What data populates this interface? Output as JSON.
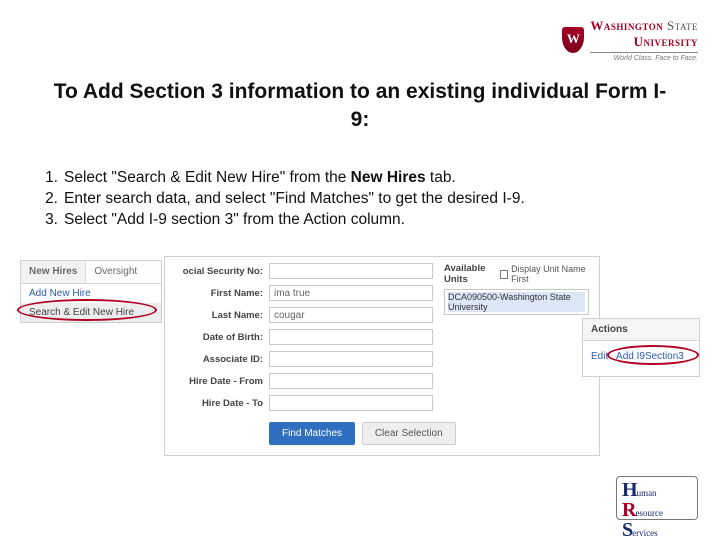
{
  "brand": {
    "wordmark_a": "Washington",
    "wordmark_b": "State",
    "wordmark_c": "University",
    "tagline": "World Class. Face to Face."
  },
  "title": "To Add Section 3 information to an existing individual Form I-9:",
  "steps": [
    {
      "n": "1.",
      "pre": "Select \"Search & Edit New Hire\" from the ",
      "bold": "New Hires",
      "post": " tab."
    },
    {
      "n": "2.",
      "pre": "Enter search data, and select \"Find Matches\" to get the desired I-9.",
      "bold": "",
      "post": ""
    },
    {
      "n": "3.",
      "pre": "Select \"Add I-9 section 3\" from the Action column.",
      "bold": "",
      "post": ""
    }
  ],
  "left_panel": {
    "tab1": "New Hires",
    "tab2": "Oversight",
    "link1": "Add New Hire",
    "link2": "Search & Edit New Hire"
  },
  "form": {
    "labels": {
      "ssn": "ocial Security No:",
      "first": "First Name:",
      "last": "Last Name:",
      "dob": "Date of Birth:",
      "assoc": "Associate ID:",
      "from": "Hire Date - From",
      "to": "Hire Date - To"
    },
    "values": {
      "first": "ima true",
      "last": "cougar"
    },
    "buttons": {
      "find": "Find Matches",
      "clear": "Clear Selection"
    }
  },
  "avail": {
    "title": "Available Units",
    "checkbox": "Display Unit Name First",
    "option": "DCA090500-Washington State University"
  },
  "actions_panel": {
    "header": "Actions",
    "edit": "Edit",
    "add": "Add I9Section3"
  },
  "hrs": {
    "l1": "uman",
    "l2": "esource",
    "l3": "ervices"
  }
}
